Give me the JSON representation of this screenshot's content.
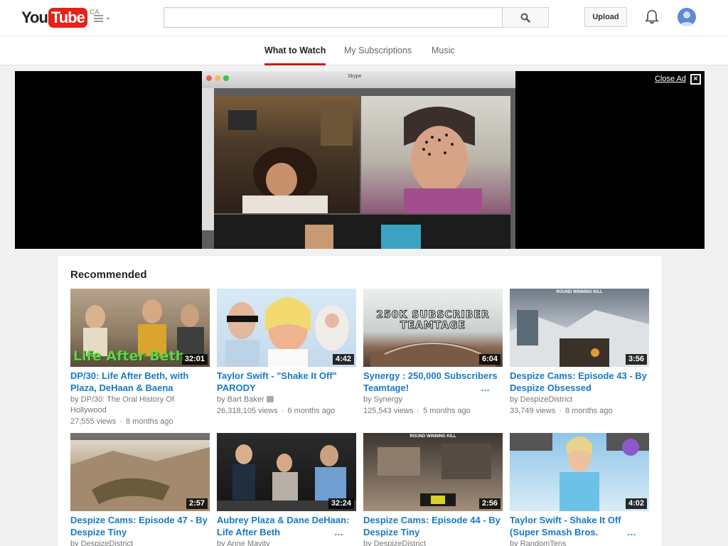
{
  "header": {
    "logo_you": "You",
    "logo_tube": "Tube",
    "country": "CA",
    "search_placeholder": "",
    "upload_label": "Upload"
  },
  "tabs": [
    {
      "label": "What to Watch",
      "active": true
    },
    {
      "label": "My Subscriptions",
      "active": false
    },
    {
      "label": "Music",
      "active": false
    }
  ],
  "ad": {
    "close_label": "Close Ad",
    "close_icon": "×",
    "window_title": "Skype"
  },
  "recommended": {
    "title": "Recommended",
    "videos": [
      {
        "title": "DP/30: Life After Beth, with Plaza, DeHaan & Baena",
        "channel": "by DP/30: The Oral History Of Hollywood",
        "views": "27,555 views",
        "age": "8 months ago",
        "duration": "32:01",
        "thumb_text": "Life After Beth"
      },
      {
        "title": "Taylor Swift - \"Shake It Off\" PARODY",
        "channel": "by Bart Baker",
        "verified": true,
        "views": "26,318,105 views",
        "age": "6 months ago",
        "duration": "4:42"
      },
      {
        "title": "Synergy : 250,000 Subscribers Teamtage!",
        "channel": "by Synergy",
        "views": "125,543 views",
        "age": "5 months ago",
        "duration": "6:04",
        "thumb_text": "250K SUBSCRIBER TEAMTAGE"
      },
      {
        "title": "Despize Cams: Episode 43 - By Despize Obsessed",
        "channel": "by DespizeDistrict",
        "views": "33,749 views",
        "age": "8 months ago",
        "duration": "3:56",
        "thumb_text": "ROUND WINNING KILL"
      },
      {
        "title": "Despize Cams: Episode 47 - By Despize Tiny",
        "channel": "by DespizeDistrict",
        "views": "",
        "age": "",
        "duration": "2:57"
      },
      {
        "title": "Aubrey Plaza & Dane DeHaan: Life After Beth",
        "channel": "by Anne Mavity",
        "views": "",
        "age": "",
        "duration": "32:24"
      },
      {
        "title": "Despize Cams: Episode 44 - By Despize Tiny",
        "channel": "by DespizeDistrict",
        "views": "",
        "age": "",
        "duration": "2:56",
        "thumb_text": "ROUND WINNING KILL"
      },
      {
        "title": "Taylor Swift - Shake It Off (Super Smash Bros.",
        "channel": "by RandomTens",
        "views": "",
        "age": "",
        "duration": "4:02"
      }
    ]
  },
  "colors": {
    "brand_red": "#e62117",
    "link_blue": "#167ac6",
    "tab_underline": "#cc181e"
  }
}
